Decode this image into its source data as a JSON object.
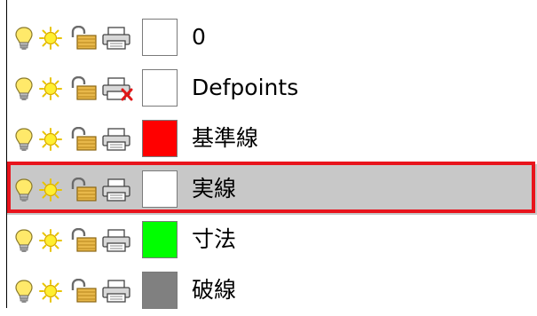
{
  "layers": [
    {
      "name": "0",
      "color": "#ffffff",
      "plot_disabled": false,
      "selected": false
    },
    {
      "name": "Defpoints",
      "color": "#ffffff",
      "plot_disabled": true,
      "selected": false
    },
    {
      "name": "基準線",
      "color": "#ff0000",
      "plot_disabled": false,
      "selected": false
    },
    {
      "name": "実線",
      "color": "#ffffff",
      "plot_disabled": false,
      "selected": true
    },
    {
      "name": "寸法",
      "color": "#00ff00",
      "plot_disabled": false,
      "selected": false
    },
    {
      "name": "破線",
      "color": "#808080",
      "plot_disabled": false,
      "selected": false
    }
  ],
  "icons": {
    "on_off": "lightbulb-icon",
    "freeze": "sun-icon",
    "lock": "lock-icon",
    "plot": "printer-icon",
    "plot_disabled": "printer-disabled-icon"
  },
  "colors": {
    "highlight_border": "#e8141c",
    "selected_row_bg": "#c8c8c8"
  }
}
